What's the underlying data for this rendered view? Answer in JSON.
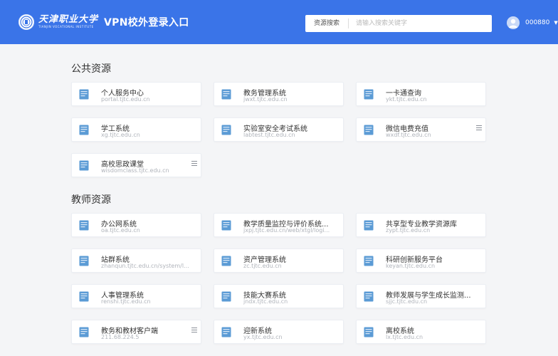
{
  "header": {
    "logo_cn": "天津职业大学",
    "logo_en": "TIANJIN VOCATIONAL INSTITUTE",
    "app_title": "VPN校外登录入口",
    "search_label": "资源搜索",
    "search_placeholder": "请输入搜索关键字",
    "username": "000880",
    "accent_color": "#3a74e8"
  },
  "sections": [
    {
      "title": "公共资源",
      "items": [
        {
          "name": "个人服务中心",
          "url": "portal.tjtc.edu.cn",
          "menu": false
        },
        {
          "name": "教务管理系统",
          "url": "jwxt.tjtc.edu.cn",
          "menu": false
        },
        {
          "name": "一卡通查询",
          "url": "ykt.tjtc.edu.cn",
          "menu": false
        },
        {
          "name": "学工系统",
          "url": "xg.tjtc.edu.cn",
          "menu": false
        },
        {
          "name": "实验室安全考试系统",
          "url": "labtest.tjtc.edu.cn",
          "menu": false
        },
        {
          "name": "微信电费充值",
          "url": "wxdf.tjtc.edu.cn",
          "menu": true
        },
        {
          "name": "高校思政课堂",
          "url": "wisdomclass.tjtc.edu.cn",
          "menu": true
        }
      ]
    },
    {
      "title": "教师资源",
      "items": [
        {
          "name": "办公网系统",
          "url": "oa.tjtc.edu.cn",
          "menu": false
        },
        {
          "name": "教学质量监控与评价系统...",
          "url": "jxpj.tjtc.edu.cn/web/xtgl/logi...",
          "menu": false
        },
        {
          "name": "共享型专业教学资源库",
          "url": "zypt.tjtc.edu.cn",
          "menu": false
        },
        {
          "name": "站群系统",
          "url": "zhanqun.tjtc.edu.cn/system/l...",
          "menu": false
        },
        {
          "name": "资产管理系统",
          "url": "zc.tjtc.edu.cn",
          "menu": false
        },
        {
          "name": "科研创新服务平台",
          "url": "keyan.tjtc.edu.cn",
          "menu": false
        },
        {
          "name": "人事管理系统",
          "url": "renshi.tjtc.edu.cn",
          "menu": false
        },
        {
          "name": "技能大赛系统",
          "url": "jndx.tjtc.edu.cn",
          "menu": false
        },
        {
          "name": "教师发展与学生成长监测...",
          "url": "sjjc.tjtc.edu.cn",
          "menu": false
        },
        {
          "name": "教务和教材客户端",
          "url": "211.68.224.5",
          "menu": true
        },
        {
          "name": "迎新系统",
          "url": "yx.tjtc.edu.cn",
          "menu": false
        },
        {
          "name": "离校系统",
          "url": "lx.tjtc.edu.cn",
          "menu": false
        }
      ]
    }
  ]
}
